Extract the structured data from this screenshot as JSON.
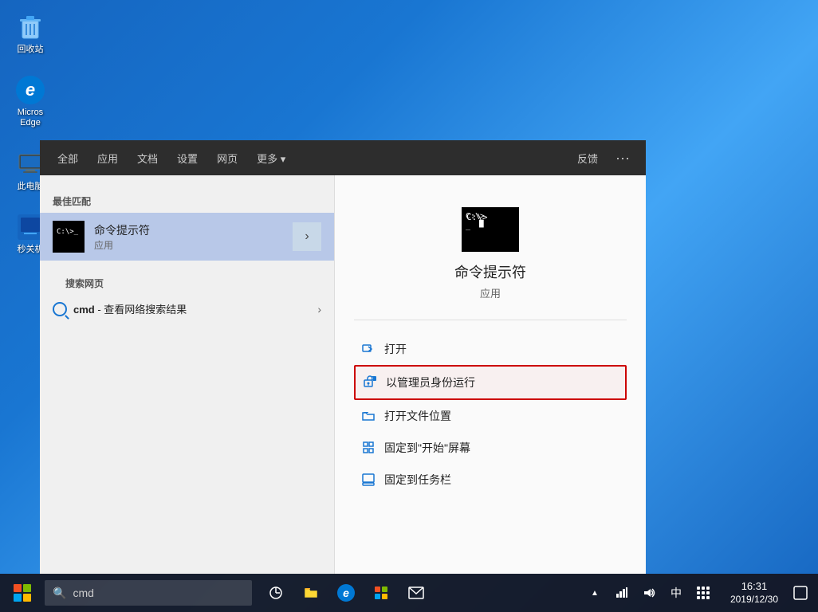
{
  "desktop": {
    "background": "blue-gradient"
  },
  "desktop_icons": [
    {
      "id": "recycle-bin",
      "label": "回收站",
      "icon": "🗑"
    },
    {
      "id": "edge",
      "label": "Micros\nEdge",
      "icon": "e"
    },
    {
      "id": "this-pc",
      "label": "此电\n脑",
      "icon": "💻"
    },
    {
      "id": "shutdown",
      "label": "秒关\n机",
      "icon": "⚡"
    }
  ],
  "search_menu": {
    "tabs": [
      "全部",
      "应用",
      "文档",
      "设置",
      "网页",
      "更多 ▾"
    ],
    "feedback_label": "反馈",
    "more_label": "···",
    "best_match_title": "最佳匹配",
    "best_match_item": {
      "name": "命令提示符",
      "type": "应用"
    },
    "search_web_title": "搜索网页",
    "search_web_item": {
      "query": "cmd",
      "suffix": " - 查看网络搜索结果"
    },
    "preview": {
      "app_name": "命令提示符",
      "app_type": "应用"
    },
    "actions": [
      {
        "id": "open",
        "label": "打开",
        "icon": "open"
      },
      {
        "id": "run-as-admin",
        "label": "以管理员身份运行",
        "icon": "admin",
        "highlighted": true
      },
      {
        "id": "open-location",
        "label": "打开文件位置",
        "icon": "folder"
      },
      {
        "id": "pin-start",
        "label": "固定到\"开始\"屏幕",
        "icon": "pin"
      },
      {
        "id": "pin-taskbar",
        "label": "固定到任务栏",
        "icon": "pin2"
      }
    ]
  },
  "taskbar": {
    "search_placeholder": "cmd",
    "time": "16:31",
    "date": "2019/12/30",
    "ime": "中"
  }
}
